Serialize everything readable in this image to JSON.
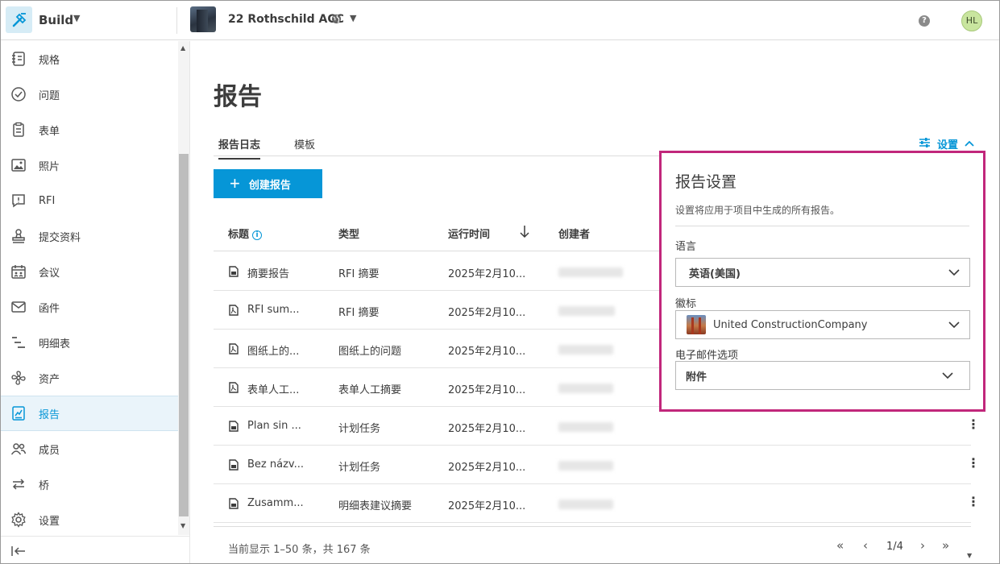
{
  "header": {
    "app_name": "Build",
    "project_name": "22 Rothschild ACC",
    "help_symbol": "?",
    "user_initials": "HL"
  },
  "sidebar": {
    "items": [
      {
        "label": "规格",
        "icon": "specs-icon"
      },
      {
        "label": "问题",
        "icon": "issues-icon"
      },
      {
        "label": "表单",
        "icon": "forms-icon"
      },
      {
        "label": "照片",
        "icon": "photos-icon"
      },
      {
        "label": "RFI",
        "icon": "rfi-icon"
      },
      {
        "label": "提交资料",
        "icon": "submittals-icon"
      },
      {
        "label": "会议",
        "icon": "meetings-icon"
      },
      {
        "label": "函件",
        "icon": "correspondence-icon"
      },
      {
        "label": "明细表",
        "icon": "schedule-icon"
      },
      {
        "label": "资产",
        "icon": "assets-icon"
      },
      {
        "label": "报告",
        "icon": "reports-icon"
      },
      {
        "label": "成员",
        "icon": "members-icon"
      },
      {
        "label": "桥",
        "icon": "bridge-icon"
      },
      {
        "label": "设置",
        "icon": "settings-icon"
      }
    ],
    "active_item": "报告"
  },
  "main": {
    "title": "报告",
    "tabs": [
      {
        "label": "报告日志"
      },
      {
        "label": "模板"
      }
    ],
    "settings_toggle_label": "设置",
    "create_button_label": "创建报告",
    "columns": {
      "title": "标题",
      "type": "类型",
      "run_time": "运行时间",
      "creator": "创建者"
    },
    "rows": [
      {
        "title": "摘要报告",
        "type": "RFI 摘要",
        "run_time": "2025年2月10..."
      },
      {
        "title": "RFI sum...",
        "type": "RFI 摘要",
        "run_time": "2025年2月10..."
      },
      {
        "title": "图纸上的...",
        "type": "图纸上的问题",
        "run_time": "2025年2月10..."
      },
      {
        "title": "表单人工...",
        "type": "表单人工摘要",
        "run_time": "2025年2月10..."
      },
      {
        "title": "Plan sin ...",
        "type": "计划任务",
        "run_time": "2025年2月10..."
      },
      {
        "title": "Bez názv...",
        "type": "计划任务",
        "run_time": "2025年2月10..."
      },
      {
        "title": "Zusamm...",
        "type": "明细表建议摘要",
        "run_time": "2025年2月10..."
      }
    ],
    "footer": {
      "count_text": "当前显示 1–50 条，共 167 条",
      "page_indicator": "1/4"
    }
  },
  "settings_panel": {
    "title": "报告设置",
    "description": "设置将应用于项目中生成的所有报告。",
    "language_label": "语言",
    "language_value": "英语(美国)",
    "logo_label": "徽标",
    "logo_value": "United ConstructionCompany",
    "email_label": "电子邮件选项",
    "email_value": "附件"
  },
  "colors": {
    "accent": "#0696d7",
    "highlight_border": "#c1277b",
    "avatar_bg": "#c9e59f"
  }
}
